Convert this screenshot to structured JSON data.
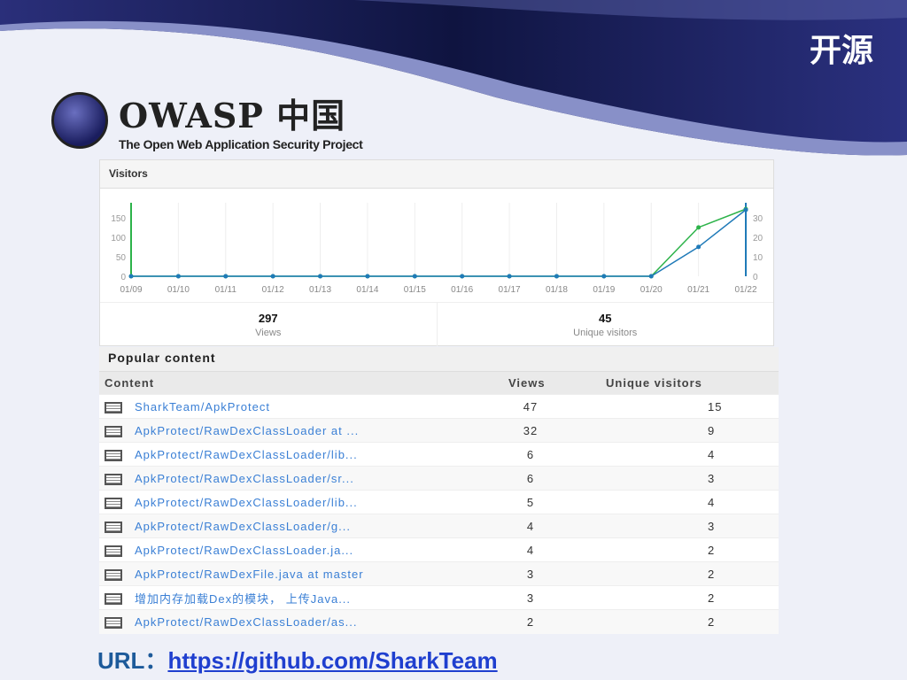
{
  "slide": {
    "title": "开源",
    "url_label": "URL：",
    "url": "https://github.com/SharkTeam"
  },
  "logo": {
    "name": "OWASP 中国",
    "tagline": "The Open Web Application Security Project"
  },
  "visitors": {
    "title": "Visitors",
    "views_total": "297",
    "views_label": "Views",
    "unique_total": "45",
    "unique_label": "Unique visitors"
  },
  "chart_data": {
    "type": "line",
    "title": "Visitors",
    "x": [
      "01/09",
      "01/10",
      "01/11",
      "01/12",
      "01/13",
      "01/14",
      "01/15",
      "01/16",
      "01/17",
      "01/18",
      "01/19",
      "01/20",
      "01/21",
      "01/22"
    ],
    "left_ticks": [
      "0",
      "50",
      "100",
      "150"
    ],
    "right_ticks": [
      "0",
      "10",
      "20",
      "30"
    ],
    "left_ylim": [
      0,
      170
    ],
    "right_ylim": [
      0,
      34
    ],
    "series": [
      {
        "name": "Views",
        "axis": "left",
        "color": "#2db34a",
        "values": [
          0,
          0,
          0,
          0,
          0,
          0,
          0,
          0,
          0,
          0,
          0,
          0,
          125,
          172
        ]
      },
      {
        "name": "Unique visitors",
        "axis": "right",
        "color": "#1f7ab8",
        "values": [
          0,
          0,
          0,
          0,
          0,
          0,
          0,
          0,
          0,
          0,
          0,
          0,
          15,
          34
        ]
      }
    ]
  },
  "popular": {
    "title": "Popular content",
    "headers": [
      "Content",
      "Views",
      "Unique visitors"
    ],
    "rows": [
      {
        "content": "SharkTeam/ApkProtect",
        "views": "47",
        "unique": "15"
      },
      {
        "content": "ApkProtect/RawDexClassLoader at ...",
        "views": "32",
        "unique": "9"
      },
      {
        "content": "ApkProtect/RawDexClassLoader/lib...",
        "views": "6",
        "unique": "4"
      },
      {
        "content": "ApkProtect/RawDexClassLoader/sr...",
        "views": "6",
        "unique": "3"
      },
      {
        "content": "ApkProtect/RawDexClassLoader/lib...",
        "views": "5",
        "unique": "4"
      },
      {
        "content": "ApkProtect/RawDexClassLoader/g...",
        "views": "4",
        "unique": "3"
      },
      {
        "content": "ApkProtect/RawDexClassLoader.ja...",
        "views": "4",
        "unique": "2"
      },
      {
        "content": "ApkProtect/RawDexFile.java at master",
        "views": "3",
        "unique": "2"
      },
      {
        "content": "增加内存加载Dex的模块， 上传Java...",
        "views": "3",
        "unique": "2"
      },
      {
        "content": "ApkProtect/RawDexClassLoader/as...",
        "views": "2",
        "unique": "2"
      }
    ]
  }
}
